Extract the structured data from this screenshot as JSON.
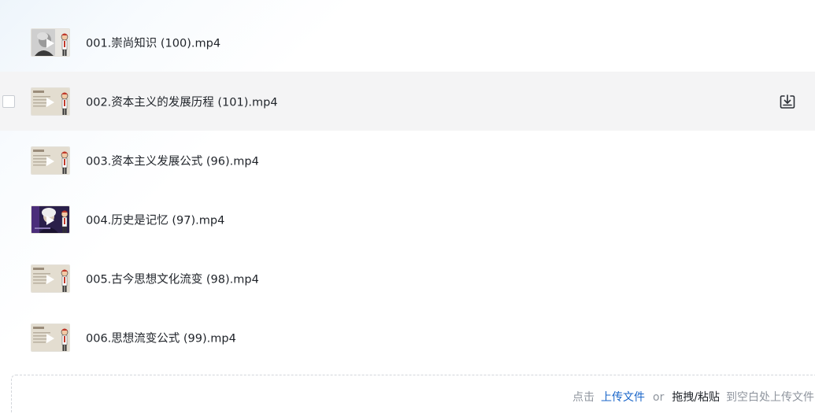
{
  "files": [
    {
      "name": "001.崇尚知识 (100).mp4",
      "thumb": "portrait-gray",
      "hover": false
    },
    {
      "name": "002.资本主义的发展历程 (101).mp4",
      "thumb": "slide",
      "hover": true
    },
    {
      "name": "003.资本主义发展公式 (96).mp4",
      "thumb": "slide",
      "hover": false
    },
    {
      "name": "004.历史是记忆 (97).mp4",
      "thumb": "portrait-purple",
      "hover": false
    },
    {
      "name": "005.古今思想文化流变 (98).mp4",
      "thumb": "slide",
      "hover": false
    },
    {
      "name": "006.思想流变公式 (99).mp4",
      "thumb": "slide",
      "hover": false
    }
  ],
  "upload": {
    "prefix": "点击",
    "upload_link": "上传文件",
    "or": "or",
    "drag_paste": "拖拽/粘贴",
    "suffix": "到空白处上传文件"
  },
  "icons": {
    "download": "download-icon",
    "play": "play-icon"
  },
  "colors": {
    "link": "#1a66c9",
    "hover_row": "#f4f4f5",
    "muted_text": "#8f959e"
  }
}
